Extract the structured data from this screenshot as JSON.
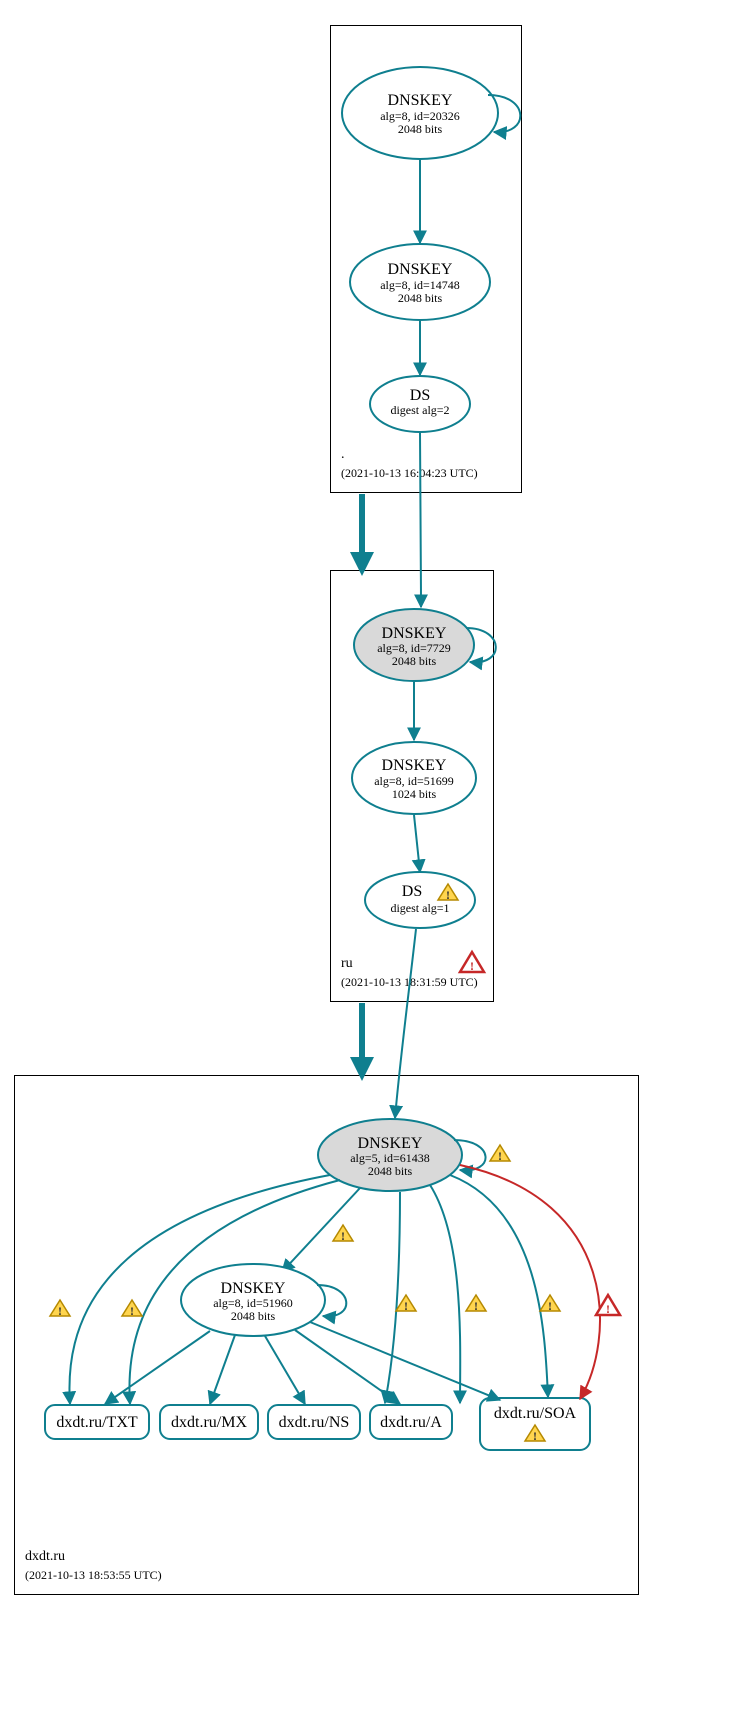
{
  "zones": {
    "root": {
      "name": ".",
      "timestamp": "(2021-10-13 16:04:23 UTC)"
    },
    "ru": {
      "name": "ru",
      "timestamp": "(2021-10-13 18:31:59 UTC)"
    },
    "dxdt": {
      "name": "dxdt.ru",
      "timestamp": "(2021-10-13 18:53:55 UTC)"
    }
  },
  "nodes": {
    "rootKSK": {
      "title": "DNSKEY",
      "line1": "alg=8, id=20326",
      "line2": "2048 bits"
    },
    "rootZSK": {
      "title": "DNSKEY",
      "line1": "alg=8, id=14748",
      "line2": "2048 bits"
    },
    "rootDS": {
      "title": "DS",
      "line1": "digest alg=2"
    },
    "ruKSK": {
      "title": "DNSKEY",
      "line1": "alg=8, id=7729",
      "line2": "2048 bits"
    },
    "ruZSK": {
      "title": "DNSKEY",
      "line1": "alg=8, id=51699",
      "line2": "1024 bits"
    },
    "ruDS": {
      "title": "DS",
      "line1": "digest alg=1"
    },
    "dxKSK": {
      "title": "DNSKEY",
      "line1": "alg=5, id=61438",
      "line2": "2048 bits"
    },
    "dxZSK": {
      "title": "DNSKEY",
      "line1": "alg=8, id=51960",
      "line2": "2048 bits"
    },
    "rrTXT": {
      "label": "dxdt.ru/TXT"
    },
    "rrMX": {
      "label": "dxdt.ru/MX"
    },
    "rrNS": {
      "label": "dxdt.ru/NS"
    },
    "rrA": {
      "label": "dxdt.ru/A"
    },
    "rrSOA": {
      "label": "dxdt.ru/SOA"
    }
  }
}
